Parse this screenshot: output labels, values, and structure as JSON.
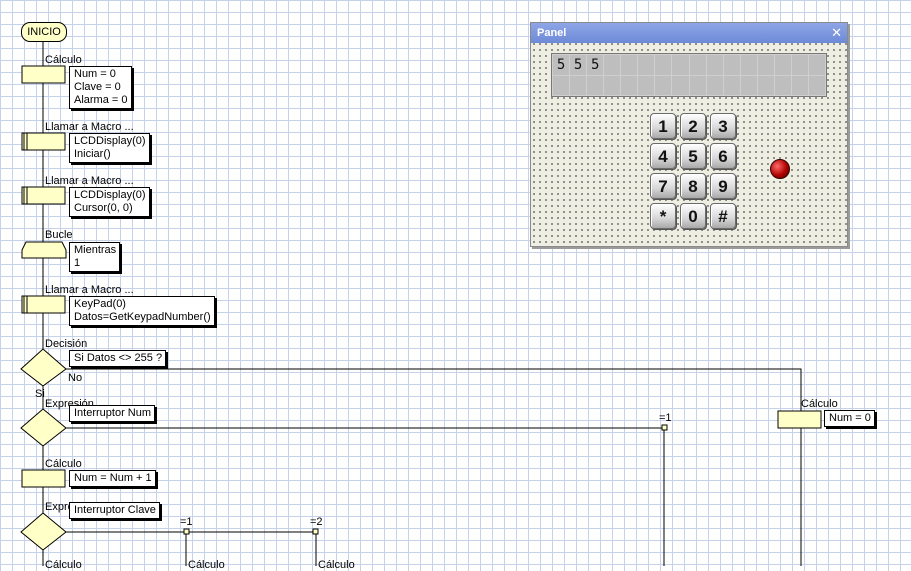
{
  "flowchart": {
    "start_label": "INICIO",
    "blocks": [
      {
        "title": "Cálculo",
        "lines": [
          "Num = 0",
          "Clave = 0",
          "Alarma = 0"
        ]
      },
      {
        "title": "Llamar a Macro ...",
        "lines": [
          "LCDDisplay(0)",
          "Iniciar()"
        ]
      },
      {
        "title": "Llamar a Macro ...",
        "lines": [
          "LCDDisplay(0)",
          "Cursor(0, 0)"
        ]
      },
      {
        "title": "Bucle",
        "lines": [
          "Mientras",
          "1"
        ]
      },
      {
        "title": "Llamar a Macro ...",
        "lines": [
          "KeyPad(0)",
          "Datos=GetKeypadNumber()"
        ]
      },
      {
        "title": "Decisión",
        "lines": [
          "Si  Datos <> 255 ?"
        ],
        "no_label": "No",
        "yes_label": "Si"
      },
      {
        "title": "Expresión",
        "lines": [
          "Interruptor Num"
        ],
        "case_label": "=1"
      },
      {
        "title": "Cálculo",
        "lines": [
          "Num = Num + 1"
        ]
      },
      {
        "title": "Expresión",
        "lines": [
          "Interruptor Clave"
        ],
        "case_labels": [
          "=1",
          "=2"
        ]
      }
    ],
    "right_block": {
      "title": "Cálculo",
      "lines": [
        "Num = 0"
      ]
    },
    "bottom_labels": [
      "Cálculo",
      "Cálculo",
      "Cálculo"
    ]
  },
  "panel": {
    "title": "Panel",
    "close_glyph": "✕",
    "lcd_row1": [
      "5",
      "5",
      "5",
      "",
      "",
      "",
      "",
      "",
      "",
      "",
      "",
      "",
      "",
      "",
      "",
      ""
    ],
    "lcd_row2": [
      "",
      "",
      "",
      "",
      "",
      "",
      "",
      "",
      "",
      "",
      "",
      "",
      "",
      "",
      "",
      ""
    ],
    "keys": [
      "1",
      "2",
      "3",
      "4",
      "5",
      "6",
      "7",
      "8",
      "9",
      "*",
      "0",
      "#"
    ],
    "led_color": "#b10000"
  },
  "colors": {
    "block_fill": "#ffffc8",
    "grid": "#c6d2ea",
    "titlebar": "#7b96df"
  }
}
